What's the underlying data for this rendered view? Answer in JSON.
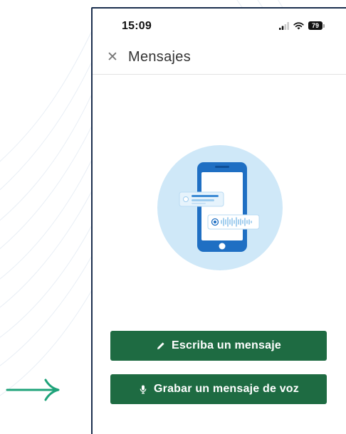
{
  "status_bar": {
    "time": "15:09",
    "battery_level": "79",
    "icons": [
      "signal-icon",
      "wifi-icon",
      "battery-icon"
    ]
  },
  "header": {
    "close_icon": "close-icon",
    "title": "Mensajes"
  },
  "illustration": {
    "name": "phone-messages-illustration"
  },
  "actions": {
    "write_label": "Escriba un mensaje",
    "write_icon": "pencil-icon",
    "voice_label": "Grabar un mensaje de voz",
    "voice_icon": "microphone-icon"
  },
  "colors": {
    "primary_button": "#1e6b42",
    "arrow_accent": "#1fa37a",
    "frame": "#1b2f4e",
    "illustration_circle": "#cfe8f8",
    "illustration_phone": "#1f6fc3"
  }
}
